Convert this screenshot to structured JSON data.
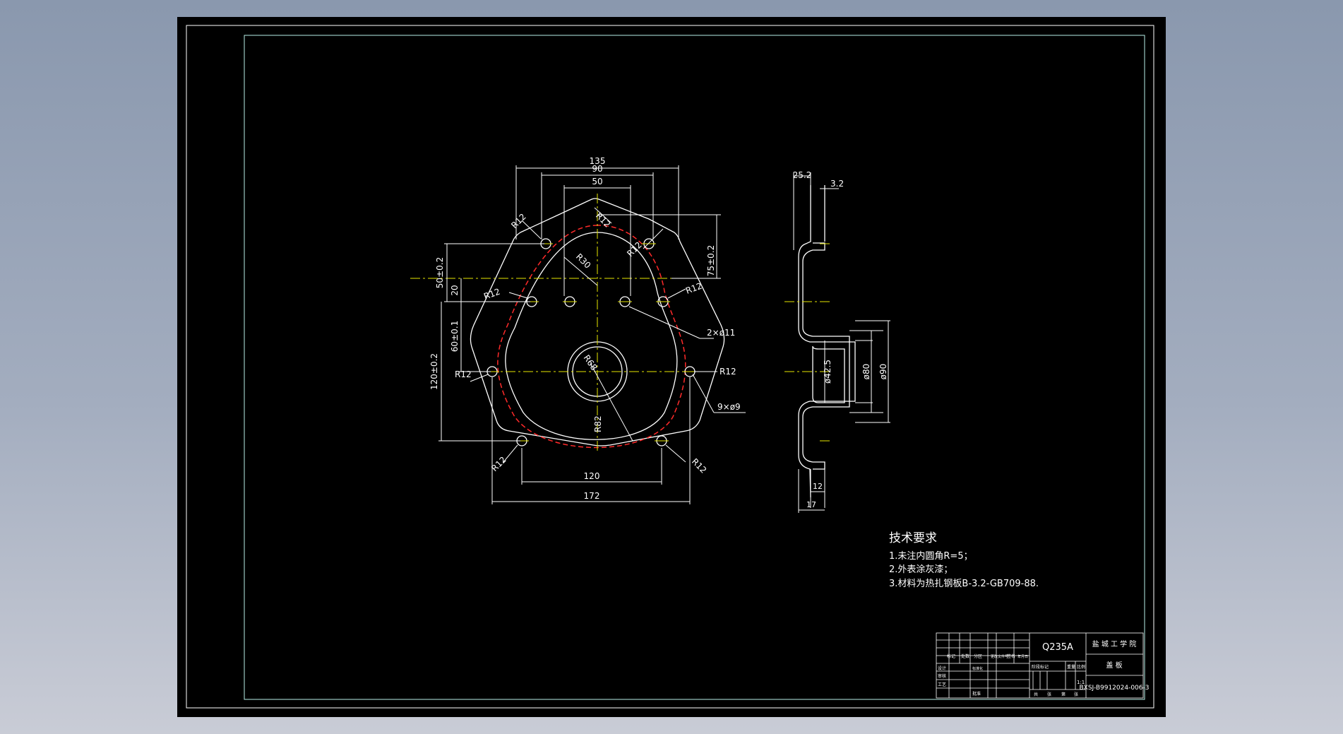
{
  "colors": {
    "background": "#000000",
    "geometry": "#ffffff",
    "centerline": "#e6e600",
    "hidden_line": "#ff2a2a",
    "border": "#b8f0e8"
  },
  "front_view": {
    "dims": {
      "w135": "135",
      "w90": "90",
      "w50": "50",
      "w120": "120",
      "w172": "172",
      "v50": "50±0.2",
      "v20": "20",
      "v60": "60±0.1",
      "v120": "120±0.2",
      "v75": "75±0.2"
    },
    "radii": {
      "r12_top_left": "R12",
      "r12_top_center": "R12",
      "r12_top_right": "R12",
      "r30": "R30",
      "r12_mid_left": "R12",
      "r12_mid_right": "R12",
      "r12_side_left": "R12",
      "r12_side_right": "R12",
      "r68": "R68",
      "r82": "R82",
      "r12_bottom_left": "R12",
      "r12_bottom_right": "R12"
    },
    "callouts": {
      "holes_2x11": "2×ø11",
      "holes_9x9": "9×ø9"
    }
  },
  "side_view": {
    "dims": {
      "d25_2": "25.2",
      "d3_2": "3.2",
      "d42_5": "ø42.5",
      "d80": "ø80",
      "d90": "ø90",
      "d12": "12",
      "d17": "17"
    }
  },
  "notes": {
    "title": "技术要求",
    "items": [
      "1.未注内圆角R=5；",
      "2.外表涂灰漆；",
      "3.材料为热扎钢板B-3.2-GB709-88."
    ]
  },
  "title_block": {
    "material": "Q235A",
    "school": "盐 城 工 学 院",
    "part_name": "盖   板",
    "drawing_no": "BXSJ-B9912024-006-3",
    "labels": {
      "biaoji": "标记",
      "chushu": "处数",
      "fenqu": "分区",
      "gengai": "更改文件号",
      "qianming": "签名",
      "nianyueri": "年月日",
      "sheji": "设计",
      "biaozhunhua": "标准化",
      "shenhe": "审核",
      "gongyi": "工艺",
      "pizhun": "批准",
      "jieduan": "阶段标记",
      "zhongliang": "重量",
      "bili": "比例",
      "scale": "1:1",
      "gong": "共",
      "zhang1": "张",
      "di": "第",
      "zhang2": "张"
    }
  }
}
